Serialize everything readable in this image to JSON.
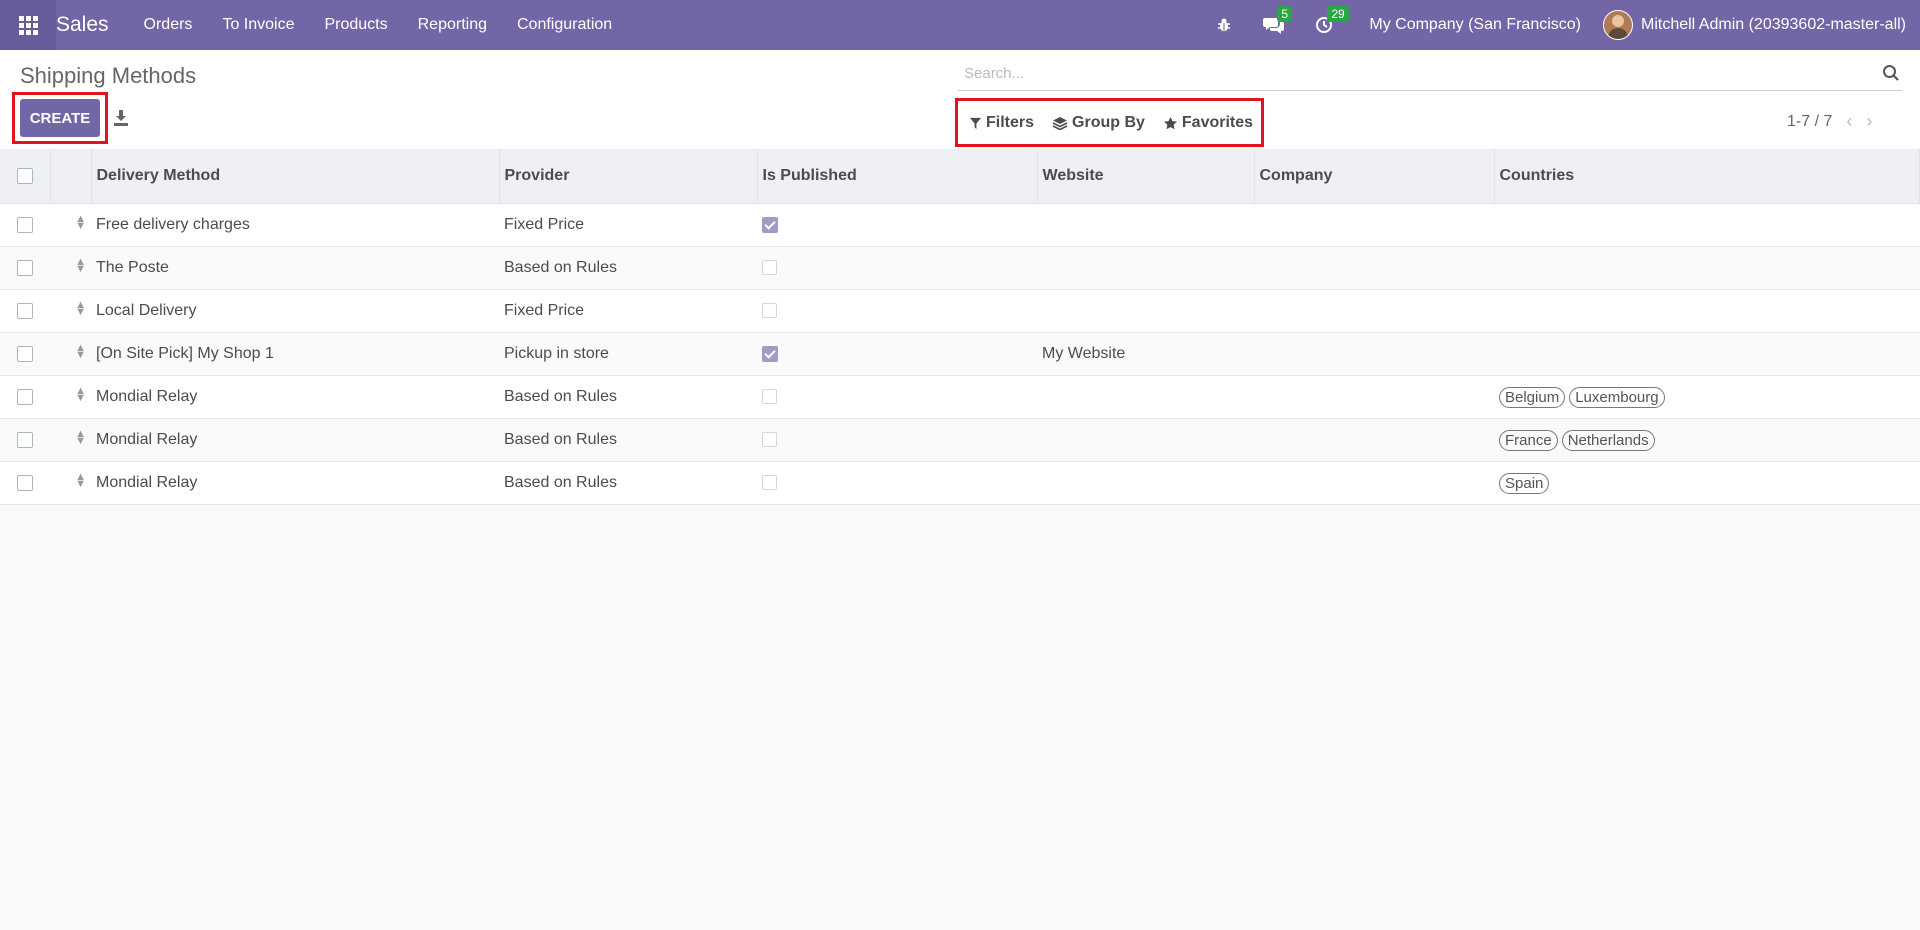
{
  "navbar": {
    "app_name": "Sales",
    "menu": [
      "Orders",
      "To Invoice",
      "Products",
      "Reporting",
      "Configuration"
    ],
    "messages_count": "5",
    "activities_count": "29",
    "company": "My Company (San Francisco)",
    "user": "Mitchell Admin (20393602-master-all)",
    "icons": [
      "apps-grid-icon",
      "bug-icon",
      "chat-icon",
      "clock-icon"
    ]
  },
  "control_panel": {
    "title": "Shipping Methods",
    "create_label": "CREATE",
    "search_placeholder": "Search...",
    "filters_label": "Filters",
    "group_by_label": "Group By",
    "favorites_label": "Favorites",
    "pager": "1-7 / 7"
  },
  "table": {
    "headers": [
      "Delivery Method",
      "Provider",
      "Is Published",
      "Website",
      "Company",
      "Countries"
    ],
    "rows": [
      {
        "name": "Free delivery charges",
        "provider": "Fixed Price",
        "published": true,
        "website": "",
        "company": "",
        "countries": []
      },
      {
        "name": "The Poste",
        "provider": "Based on Rules",
        "published": false,
        "website": "",
        "company": "",
        "countries": []
      },
      {
        "name": "Local Delivery",
        "provider": "Fixed Price",
        "published": false,
        "website": "",
        "company": "",
        "countries": []
      },
      {
        "name": "[On Site Pick] My Shop 1",
        "provider": "Pickup in store",
        "published": true,
        "website": "My Website",
        "company": "",
        "countries": []
      },
      {
        "name": "Mondial Relay",
        "provider": "Based on Rules",
        "published": false,
        "website": "",
        "company": "",
        "countries": [
          "Belgium",
          "Luxembourg"
        ]
      },
      {
        "name": "Mondial Relay",
        "provider": "Based on Rules",
        "published": false,
        "website": "",
        "company": "",
        "countries": [
          "France",
          "Netherlands"
        ]
      },
      {
        "name": "Mondial Relay",
        "provider": "Based on Rules",
        "published": false,
        "website": "",
        "company": "",
        "countries": [
          "Spain"
        ]
      }
    ]
  },
  "colors": {
    "brand": "#7266a6",
    "highlight": "#e0131e",
    "badge": "#28a745"
  }
}
